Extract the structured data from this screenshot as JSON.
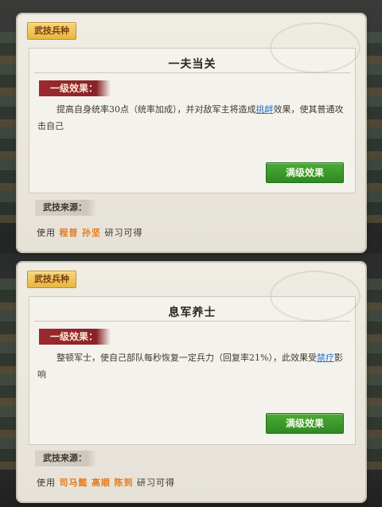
{
  "panels": [
    {
      "tag": "武技兵种",
      "skill_name": "一夫当关",
      "level_tag": "一级效果：",
      "desc_part1": "提高自身统率30点（统率加成），并对敌军主将造成",
      "desc_keyword": "挑衅",
      "desc_part2": "效果，使其普通攻击自己",
      "max_button": "满级效果",
      "source_label": "武技来源：",
      "source_prefix": "使用",
      "source_items": [
        "程普",
        "孙坚"
      ],
      "source_suffix": "研习可得"
    },
    {
      "tag": "武技兵种",
      "skill_name": "息军养士",
      "level_tag": "一级效果：",
      "desc_part1": "整顿军士，使自己部队每秒恢复一定兵力（回复率21%），此效果受",
      "desc_keyword": "禁疗",
      "desc_part2": "影响",
      "max_button": "满级效果",
      "source_label": "武技来源：",
      "source_prefix": "使用",
      "source_items": [
        "司马懿",
        "高顺",
        "陈到"
      ],
      "source_suffix": "研习可得"
    }
  ],
  "colors": {
    "tag_gold": "#f0c75a",
    "tag_red": "#8f252a",
    "button_green": "#3a9a2c",
    "keyword_blue": "#2b79c9",
    "keyword_orange": "#e47a1c"
  }
}
